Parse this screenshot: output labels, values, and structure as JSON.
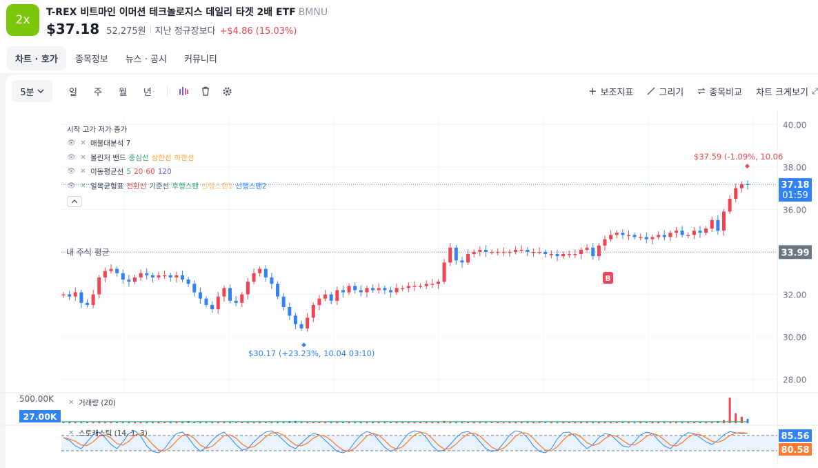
{
  "header": {
    "logo_text": "2x",
    "title": "T-REX 비트마인 이머션 테크놀로지스 데일리 타겟 2배 ETF",
    "ticker": "BMNU",
    "price": "$37.18",
    "krw": "52,275원",
    "compare": "지난 정규장보다",
    "change": "+$4.86 (15.03%)"
  },
  "tabs": [
    "차트 · 호가",
    "종목정보",
    "뉴스 · 공시",
    "커뮤니티"
  ],
  "toolbar": {
    "timeframe": "5분",
    "periods": [
      "일",
      "주",
      "월",
      "년"
    ],
    "icons": [
      "indicator-bars-icon",
      "trash-icon",
      "gear-icon"
    ],
    "right": [
      "보조지표",
      "그리기",
      "종목비교",
      "차트 크게보기"
    ]
  },
  "legend": {
    "ohlc": "시작 고가 저가 종가",
    "volume_profile": "매물대분석 7",
    "bollinger_label": "볼린저 밴드",
    "bollinger_mid": "중심선",
    "bollinger_upper": "상한선",
    "bollinger_lower": "하한선",
    "ma_label": "이동평균선",
    "ma_values": [
      "5",
      "20",
      "60",
      "120"
    ],
    "ichimoku_label": "일목균형표",
    "ichimoku_items": [
      "전환선",
      "기준선",
      "후행스팬",
      "선행스팬1",
      "선행스팬2"
    ]
  },
  "chart_data": {
    "type": "candlestick",
    "ylim": [
      27.5,
      40.4
    ],
    "y_ticks": [
      "40.00",
      "38.00",
      "36.00",
      "34.00",
      "32.00",
      "30.00",
      "28.00"
    ],
    "current_price": "37.18",
    "countdown": "01:59",
    "avg_price": "33.99",
    "avg_label": "내 주식 평균",
    "high_annotation": "$37.59 (-1.09%, 10.06",
    "low_annotation": "$30.17 (+23.23%, 10.04 03:10)",
    "buy_marker": "B",
    "closes": [
      32.0,
      31.9,
      32.1,
      31.6,
      31.5,
      32.0,
      32.8,
      33.1,
      33.2,
      33.0,
      32.7,
      32.6,
      32.8,
      33.0,
      32.9,
      32.8,
      32.9,
      32.9,
      32.8,
      32.9,
      32.7,
      32.5,
      32.1,
      31.8,
      31.5,
      31.3,
      31.9,
      32.3,
      31.7,
      31.6,
      32.0,
      32.6,
      33.0,
      33.2,
      32.8,
      32.5,
      31.9,
      31.4,
      31.0,
      30.6,
      30.4,
      30.9,
      31.5,
      31.8,
      32.0,
      31.7,
      32.2,
      32.1,
      32.4,
      32.2,
      32.1,
      32.3,
      32.2,
      32.3,
      32.2,
      32.1,
      32.3,
      32.3,
      32.4,
      32.4,
      32.4,
      32.5,
      32.5,
      32.6,
      33.5,
      34.2,
      33.6,
      33.5,
      33.9,
      34.0,
      34.1,
      34.0,
      34.0,
      34.0,
      34.0,
      34.0,
      34.1,
      34.1,
      34.0,
      34.0,
      34.0,
      33.9,
      33.9,
      33.8,
      33.9,
      33.9,
      33.9,
      34.1,
      34.2,
      33.8,
      34.3,
      34.6,
      34.8,
      34.9,
      34.8,
      34.8,
      34.7,
      34.7,
      34.6,
      34.7,
      34.8,
      34.7,
      34.9,
      35.0,
      34.8,
      34.8,
      35.0,
      34.9,
      35.1,
      35.5,
      35.0,
      35.9,
      36.5,
      37.0,
      37.2,
      37.18
    ]
  },
  "volume": {
    "label": "거래량 (20)",
    "max_label": "500.00K",
    "current": "27.00K",
    "values": [
      12,
      10,
      8,
      9,
      11,
      7,
      14,
      9,
      8,
      10,
      12,
      9,
      7,
      8,
      10,
      9,
      11,
      8,
      9,
      10,
      12,
      14,
      9,
      8,
      11,
      10,
      9,
      8,
      12,
      10,
      9,
      8,
      11,
      13,
      9,
      10,
      12,
      11,
      14,
      16,
      12,
      10,
      9,
      8,
      10,
      11,
      9,
      8,
      7,
      9,
      8,
      7,
      9,
      10,
      8,
      7,
      8,
      9,
      8,
      7,
      9,
      8,
      10,
      12,
      16,
      11,
      9,
      8,
      7,
      8,
      9,
      7,
      8,
      7,
      6,
      8,
      7,
      9,
      8,
      7,
      6,
      8,
      7,
      6,
      8,
      7,
      9,
      8,
      10,
      12,
      9,
      8,
      7,
      9,
      8,
      7,
      6,
      8,
      7,
      9,
      8,
      10,
      9,
      8,
      7,
      9,
      8,
      10,
      12,
      11,
      14,
      22,
      180,
      70,
      45,
      30
    ]
  },
  "stochastic": {
    "label": "스토캐스틱 (14, 1, 3)",
    "k_value": "85.56",
    "d_value": "80.58",
    "k": [
      70,
      60,
      40,
      30,
      55,
      80,
      90,
      70,
      45,
      30,
      55,
      85,
      95,
      75,
      40,
      20,
      15,
      30,
      60,
      85,
      90,
      70,
      40,
      20,
      35,
      60,
      80,
      90,
      70,
      45,
      25,
      30,
      55,
      75,
      90,
      95,
      80,
      60,
      40,
      30,
      50,
      70,
      85,
      80,
      60,
      40,
      20,
      15,
      25,
      55,
      80,
      92,
      85,
      60,
      35,
      20,
      30,
      60,
      85,
      95,
      90,
      70,
      40,
      20,
      25,
      45,
      70,
      88,
      92,
      80,
      55,
      30,
      20,
      25,
      50,
      80,
      95,
      90,
      70,
      40,
      20,
      15,
      30,
      65,
      88,
      90,
      75,
      50,
      30,
      45,
      70,
      85,
      80,
      60,
      40,
      35,
      55,
      80,
      90,
      85,
      60,
      40,
      30,
      50,
      75,
      88,
      85,
      70,
      55,
      45,
      60,
      80,
      92,
      88,
      84,
      86
    ]
  }
}
